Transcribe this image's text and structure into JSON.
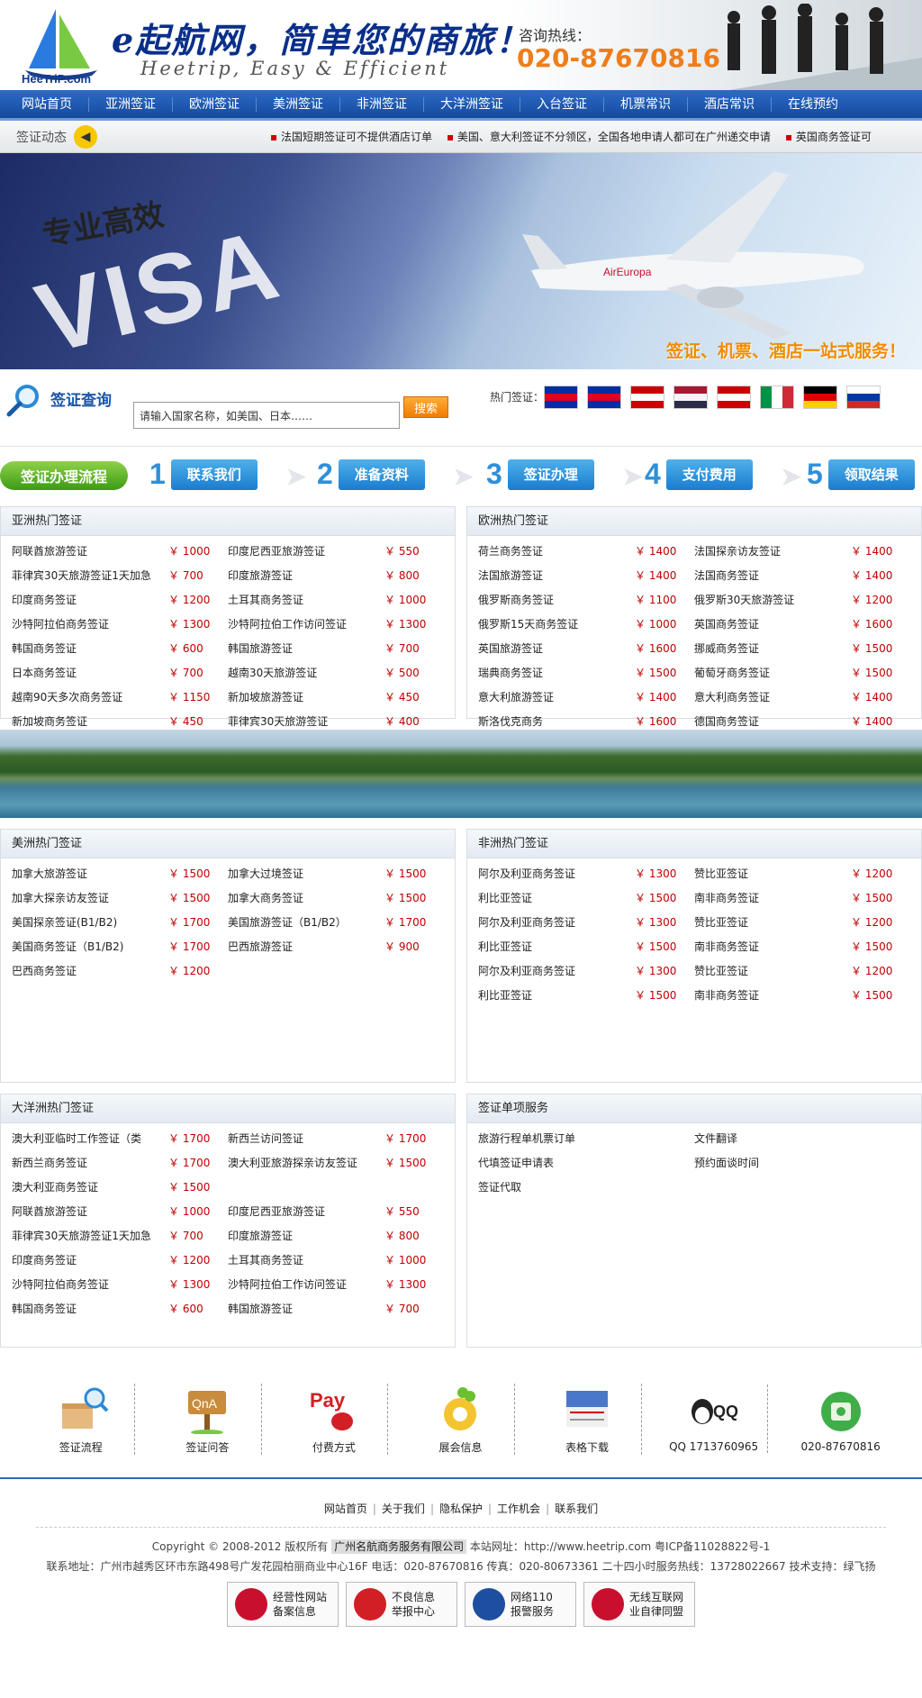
{
  "header": {
    "logo_text": "HeeTriP.com",
    "slogan": "e起航网，简单您的商旅！",
    "slogan_en": "Heetrip, Easy & Efficient",
    "hotline_label": "咨询热线：",
    "hotline": "020-87670816"
  },
  "nav": [
    "网站首页",
    "亚洲签证",
    "欧洲签证",
    "美洲签证",
    "非洲签证",
    "大洋洲签证",
    "入台签证",
    "机票常识",
    "酒店常识",
    "在线预约"
  ],
  "ticker": {
    "label": "签证动态",
    "items": [
      "法国短期签证可不提供酒店订单",
      "美国、意大利签证不分领区，全国各地申请人都可在广州递交申请",
      "英国商务签证可"
    ]
  },
  "banner": {
    "cn_title": "专业高效",
    "visa": "VISA",
    "tagline": "签证、机票、酒店一站式服务！"
  },
  "search": {
    "title": "签证查询",
    "placeholder": "请输入国家名称，如美国、日本……",
    "button": "搜索",
    "hot_label": "热门签证："
  },
  "flags": [
    {
      "name": "cambodia-flag",
      "colors": [
        "#032ea1",
        "#e00025",
        "#032ea1"
      ]
    },
    {
      "name": "cambodia-flag-2",
      "colors": [
        "#032ea1",
        "#e00025",
        "#032ea1"
      ]
    },
    {
      "name": "malaysia-flag",
      "colors": [
        "#cc0001",
        "#ffffff",
        "#cc0001"
      ]
    },
    {
      "name": "thailand-flag",
      "colors": [
        "#a51931",
        "#f4f5f8",
        "#2d2a4a"
      ]
    },
    {
      "name": "malaysia-flag-2",
      "colors": [
        "#cc0001",
        "#ffffff",
        "#cc0001"
      ]
    },
    {
      "name": "italy-flag",
      "colors": [
        "#009246",
        "#ffffff",
        "#ce2b37"
      ]
    },
    {
      "name": "germany-flag",
      "colors": [
        "#000000",
        "#dd0000",
        "#ffce00"
      ]
    },
    {
      "name": "russia-flag",
      "colors": [
        "#ffffff",
        "#0039a6",
        "#d52b1e"
      ]
    }
  ],
  "process": {
    "start": "签证办理流程",
    "steps": [
      {
        "num": "1",
        "label": "联系我们"
      },
      {
        "num": "2",
        "label": "准备资料"
      },
      {
        "num": "3",
        "label": "签证办理"
      },
      {
        "num": "4",
        "label": "支付费用"
      },
      {
        "num": "5",
        "label": "领取结果"
      }
    ]
  },
  "panels": {
    "asia": {
      "title": "亚洲热门签证",
      "rows": [
        [
          "阿联酋旅游签证",
          "￥ 1000"
        ],
        [
          "印度尼西亚旅游签证",
          "￥ 550"
        ],
        [
          "菲律宾30天旅游签证1天加急",
          "￥ 700"
        ],
        [
          "印度旅游签证",
          "￥ 800"
        ],
        [
          "印度商务签证",
          "￥ 1200"
        ],
        [
          "土耳其商务签证",
          "￥ 1000"
        ],
        [
          "沙特阿拉伯商务签证",
          "￥ 1300"
        ],
        [
          "沙特阿拉伯工作访问签证",
          "￥ 1300"
        ],
        [
          "韩国商务签证",
          "￥ 600"
        ],
        [
          "韩国旅游签证",
          "￥ 700"
        ],
        [
          "日本商务签证",
          "￥ 700"
        ],
        [
          "越南30天旅游签证",
          "￥ 500"
        ],
        [
          "越南90天多次商务签证",
          "￥ 1150"
        ],
        [
          "新加坡旅游签证",
          "￥ 450"
        ],
        [
          "新加坡商务签证",
          "￥ 450"
        ],
        [
          "菲律宾30天旅游签证",
          "￥ 400"
        ]
      ]
    },
    "europe": {
      "title": "欧洲热门签证",
      "rows": [
        [
          "荷兰商务签证",
          "￥ 1400"
        ],
        [
          "法国探亲访友签证",
          "￥ 1400"
        ],
        [
          "法国旅游签证",
          "￥ 1400"
        ],
        [
          "法国商务签证",
          "￥ 1400"
        ],
        [
          "俄罗斯商务签证",
          "￥ 1100"
        ],
        [
          "俄罗斯30天旅游签证",
          "￥ 1200"
        ],
        [
          "俄罗斯15天商务签证",
          "￥ 1000"
        ],
        [
          "英国商务签证",
          "￥ 1600"
        ],
        [
          "英国旅游签证",
          "￥ 1600"
        ],
        [
          "挪威商务签证",
          "￥ 1500"
        ],
        [
          "瑞典商务签证",
          "￥ 1500"
        ],
        [
          "葡萄牙商务签证",
          "￥ 1500"
        ],
        [
          "意大利旅游签证",
          "￥ 1400"
        ],
        [
          "意大利商务签证",
          "￥ 1400"
        ],
        [
          "斯洛伐克商务",
          "￥ 1600"
        ],
        [
          "德国商务签证",
          "￥ 1400"
        ]
      ]
    },
    "america": {
      "title": "美洲热门签证",
      "rows": [
        [
          "加拿大旅游签证",
          "￥ 1500"
        ],
        [
          "加拿大过境签证",
          "￥ 1500"
        ],
        [
          "加拿大探亲访友签证",
          "￥ 1500"
        ],
        [
          "加拿大商务签证",
          "￥ 1500"
        ],
        [
          "美国探亲签证(B1/B2)",
          "￥ 1700"
        ],
        [
          "美国旅游签证（B1/B2）",
          "￥ 1700"
        ],
        [
          "美国商务签证（B1/B2)",
          "￥ 1700"
        ],
        [
          "巴西旅游签证",
          "￥ 900"
        ],
        [
          "巴西商务签证",
          "￥ 1200"
        ]
      ]
    },
    "africa": {
      "title": "非洲热门签证",
      "rows": [
        [
          "阿尔及利亚商务签证",
          "￥ 1300"
        ],
        [
          "赞比亚签证",
          "￥ 1200"
        ],
        [
          "利比亚签证",
          "￥ 1500"
        ],
        [
          "南非商务签证",
          "￥ 1500"
        ],
        [
          "阿尔及利亚商务签证",
          "￥ 1300"
        ],
        [
          "赞比亚签证",
          "￥ 1200"
        ],
        [
          "利比亚签证",
          "￥ 1500"
        ],
        [
          "南非商务签证",
          "￥ 1500"
        ],
        [
          "阿尔及利亚商务签证",
          "￥ 1300"
        ],
        [
          "赞比亚签证",
          "￥ 1200"
        ],
        [
          "利比亚签证",
          "￥ 1500"
        ],
        [
          "南非商务签证",
          "￥ 1500"
        ]
      ]
    },
    "oceania": {
      "title": "大洋洲热门签证",
      "rows": [
        [
          "澳大利亚临时工作签证（类",
          "￥ 1700"
        ],
        [
          "新西兰访问签证",
          "￥ 1700"
        ],
        [
          "新西兰商务签证",
          "￥ 1700"
        ],
        [
          "澳大利亚旅游探亲访友签证",
          "￥ 1500"
        ],
        [
          "澳大利亚商务签证",
          "￥ 1500"
        ],
        [
          "",
          ""
        ],
        [
          "阿联酋旅游签证",
          "￥ 1000"
        ],
        [
          "印度尼西亚旅游签证",
          "￥ 550"
        ],
        [
          "菲律宾30天旅游签证1天加急",
          "￥ 700"
        ],
        [
          "印度旅游签证",
          "￥ 800"
        ],
        [
          "印度商务签证",
          "￥ 1200"
        ],
        [
          "土耳其商务签证",
          "￥ 1000"
        ],
        [
          "沙特阿拉伯商务签证",
          "￥ 1300"
        ],
        [
          "沙特阿拉伯工作访问签证",
          "￥ 1300"
        ],
        [
          "韩国商务签证",
          "￥ 600"
        ],
        [
          "韩国旅游签证",
          "￥ 700"
        ]
      ]
    },
    "services": {
      "title": "签证单项服务",
      "rows": [
        [
          "旅游行程单机票订单",
          ""
        ],
        [
          "文件翻译",
          ""
        ],
        [
          "代填签证申请表",
          ""
        ],
        [
          "预约面谈时间",
          ""
        ],
        [
          "签证代取",
          ""
        ]
      ]
    }
  },
  "footer_icons": [
    {
      "icon": "box-search-icon",
      "label": "签证流程"
    },
    {
      "icon": "qna-sign-icon",
      "label": "签证问答"
    },
    {
      "icon": "pay-mouse-icon",
      "label": "付费方式"
    },
    {
      "icon": "clover-icon",
      "label": "展会信息"
    },
    {
      "icon": "form-download-icon",
      "label": "表格下载"
    },
    {
      "icon": "qq-icon",
      "label": "QQ 1713760965"
    },
    {
      "icon": "phone-icon",
      "label": "020-87670816"
    }
  ],
  "footer_links": [
    "网站首页",
    "关于我们",
    "隐私保护",
    "工作机会",
    "联系我们"
  ],
  "copyright": {
    "pre": "Copyright © 2008-2012   版权所有",
    "company": "广州名航商务服务有限公司",
    "post": "本站网址：http://www.heetrip.com 粤ICP备11028822号-1"
  },
  "address": "联系地址：广州市越秀区环市东路498号广发花园柏丽商业中心16F 电话：020-87670816 传真：020-80673361 二十四小时服务热线：13728022667 技术支持：绿飞扬",
  "badges": [
    {
      "line1": "经营性网站",
      "line2": "备案信息",
      "color": "#c8102e"
    },
    {
      "line1": "不良信息",
      "line2": "举报中心",
      "color": "#d21f26"
    },
    {
      "line1": "网络110",
      "line2": "报警服务",
      "color": "#1d4fa0"
    },
    {
      "line1": "无线互联网",
      "line2": "业自律同盟",
      "color": "#c8102e"
    }
  ]
}
